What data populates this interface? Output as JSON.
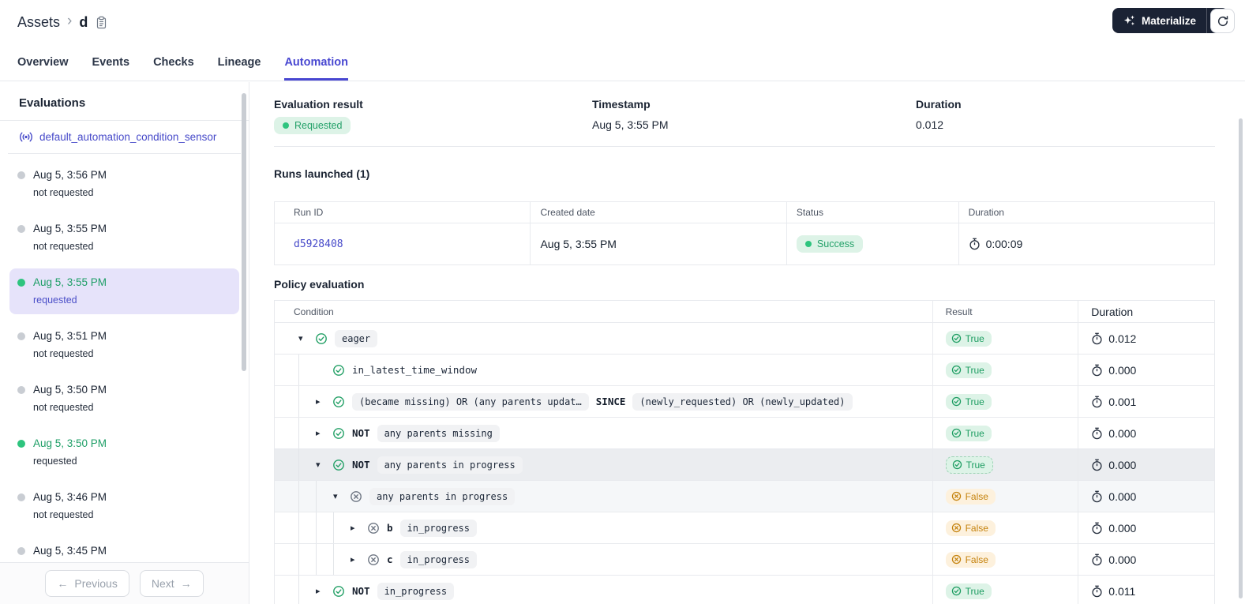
{
  "header": {
    "breadcrumb": {
      "root": "Assets",
      "current": "d"
    },
    "materialize_label": "Materialize"
  },
  "tabs": [
    {
      "label": "Overview",
      "active": false
    },
    {
      "label": "Events",
      "active": false
    },
    {
      "label": "Checks",
      "active": false
    },
    {
      "label": "Lineage",
      "active": false
    },
    {
      "label": "Automation",
      "active": true
    }
  ],
  "sidebar": {
    "title": "Evaluations",
    "sensor_link": "default_automation_condition_sensor",
    "items": [
      {
        "time": "Aug 5, 3:56 PM",
        "status": "not requested",
        "dot": "gray",
        "time_color": "default",
        "status_color": "default",
        "selected": false
      },
      {
        "time": "Aug 5, 3:55 PM",
        "status": "not requested",
        "dot": "gray",
        "time_color": "default",
        "status_color": "default",
        "selected": false
      },
      {
        "time": "Aug 5, 3:55 PM",
        "status": "requested",
        "dot": "green",
        "time_color": "green",
        "status_color": "purple",
        "selected": true
      },
      {
        "time": "Aug 5, 3:51 PM",
        "status": "not requested",
        "dot": "gray",
        "time_color": "default",
        "status_color": "default",
        "selected": false
      },
      {
        "time": "Aug 5, 3:50 PM",
        "status": "not requested",
        "dot": "gray",
        "time_color": "default",
        "status_color": "default",
        "selected": false
      },
      {
        "time": "Aug 5, 3:50 PM",
        "status": "requested",
        "dot": "green",
        "time_color": "green",
        "status_color": "default",
        "selected": false
      },
      {
        "time": "Aug 5, 3:46 PM",
        "status": "not requested",
        "dot": "gray",
        "time_color": "default",
        "status_color": "default",
        "selected": false
      },
      {
        "time": "Aug 5, 3:45 PM",
        "status": "",
        "dot": "gray",
        "time_color": "default",
        "status_color": "default",
        "selected": false
      }
    ],
    "pagination": {
      "previous": "Previous",
      "next": "Next",
      "prev_arrow": "←",
      "next_arrow": "→"
    }
  },
  "summary": {
    "result_label": "Evaluation result",
    "result_value": "Requested",
    "timestamp_label": "Timestamp",
    "timestamp_value": "Aug 5, 3:55 PM",
    "duration_label": "Duration",
    "duration_value": "0.012"
  },
  "runs": {
    "title": "Runs launched (1)",
    "columns": [
      "Run ID",
      "Created date",
      "Status",
      "Duration"
    ],
    "rows": [
      {
        "run_id": "d5928408",
        "created": "Aug 5, 3:55 PM",
        "status": "Success",
        "duration": "0:00:09"
      }
    ]
  },
  "policy": {
    "title": "Policy evaluation",
    "columns": [
      "Condition",
      "Result",
      "Duration"
    ],
    "rows": [
      {
        "depth": 0,
        "expander": "down",
        "icon": "check",
        "parts": [
          {
            "type": "chip",
            "text": "eager"
          }
        ],
        "result": "True",
        "duration": "0.012",
        "highlight": "none"
      },
      {
        "depth": 1,
        "expander": "none",
        "icon": "check",
        "parts": [
          {
            "type": "plain",
            "text": "in_latest_time_window"
          }
        ],
        "result": "True",
        "duration": "0.000",
        "highlight": "none"
      },
      {
        "depth": 1,
        "expander": "right",
        "icon": "check",
        "parts": [
          {
            "type": "chip",
            "text": "(became missing) OR (any parents updat…"
          },
          {
            "type": "kw",
            "text": "SINCE"
          },
          {
            "type": "chip",
            "text": "(newly_requested) OR (newly_updated)"
          }
        ],
        "result": "True",
        "duration": "0.001",
        "highlight": "none"
      },
      {
        "depth": 1,
        "expander": "right",
        "icon": "check",
        "parts": [
          {
            "type": "kw",
            "text": "NOT"
          },
          {
            "type": "chip",
            "text": "any parents missing"
          }
        ],
        "result": "True",
        "duration": "0.000",
        "highlight": "none"
      },
      {
        "depth": 1,
        "expander": "down",
        "icon": "check",
        "parts": [
          {
            "type": "kw",
            "text": "NOT"
          },
          {
            "type": "chip",
            "text": "any parents in progress"
          }
        ],
        "result": "True",
        "duration": "0.000",
        "highlight": "hover"
      },
      {
        "depth": 2,
        "expander": "down",
        "icon": "cross",
        "parts": [
          {
            "type": "chip",
            "text": "any parents in progress"
          }
        ],
        "result": "False",
        "duration": "0.000",
        "highlight": "soft"
      },
      {
        "depth": 3,
        "expander": "right",
        "icon": "cross",
        "parts": [
          {
            "type": "kw",
            "text": "b"
          },
          {
            "type": "chip",
            "text": "in_progress"
          }
        ],
        "result": "False",
        "duration": "0.000",
        "highlight": "none"
      },
      {
        "depth": 3,
        "expander": "right",
        "icon": "cross",
        "parts": [
          {
            "type": "kw",
            "text": "c"
          },
          {
            "type": "chip",
            "text": "in_progress"
          }
        ],
        "result": "False",
        "duration": "0.000",
        "highlight": "none"
      },
      {
        "depth": 1,
        "expander": "right",
        "icon": "check",
        "parts": [
          {
            "type": "kw",
            "text": "NOT"
          },
          {
            "type": "chip",
            "text": "in_progress"
          }
        ],
        "result": "True",
        "duration": "0.011",
        "highlight": "none"
      }
    ]
  },
  "colors": {
    "accent": "#4847d1",
    "link": "#4649c9",
    "green_dot": "#2ec47e",
    "green_text": "#1f9e63",
    "orange_text": "#c5830e",
    "badge_green_bg": "#ddf3e7",
    "badge_orange_bg": "#fdf1dd",
    "dark_button_bg": "#1a2234",
    "selected_item_bg": "#e6e3fa"
  }
}
